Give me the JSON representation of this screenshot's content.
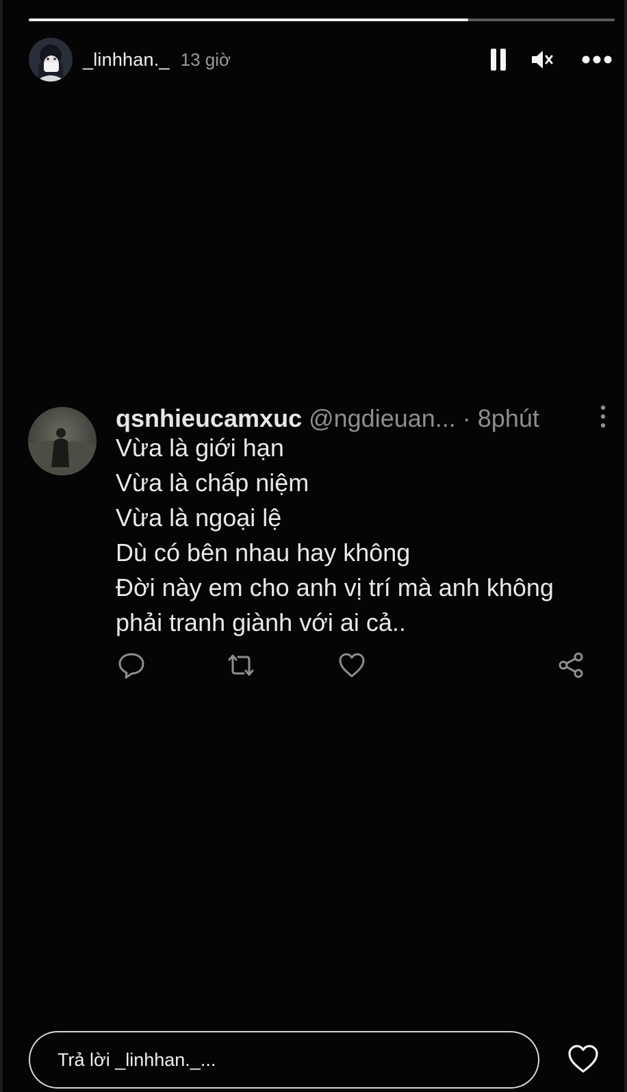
{
  "story": {
    "progress_fraction": 0.75,
    "progress_color": "#f2f2f2",
    "progress_track_color": "#5a5a5a"
  },
  "header": {
    "username": "_linhhan._",
    "time_ago": "13 giờ",
    "avatar_icon": "profile-avatar",
    "pause_icon": "pause-icon",
    "mute_icon": "speaker-muted-icon",
    "more_icon": "more-horizontal-icon"
  },
  "tweet": {
    "display_name": "qsnhieucamxuc",
    "handle": "@ngdieuan...",
    "time": "· 8phút",
    "lines": [
      "Vừa là giới hạn",
      "Vừa là chấp niệm",
      "Vừa là ngoại lệ",
      "Dù có bên nhau hay không",
      "Đời này em cho anh vị trí mà anh không",
      "phải tranh giành với ai cả.."
    ],
    "actions": [
      "reply-icon",
      "retweet-icon",
      "like-icon",
      "share-icon"
    ]
  },
  "reply": {
    "placeholder": "Trả lời _linhhan._..."
  },
  "colors": {
    "background": "#050505",
    "text_primary": "#e9e9e9",
    "text_secondary": "#8e8e8e"
  }
}
